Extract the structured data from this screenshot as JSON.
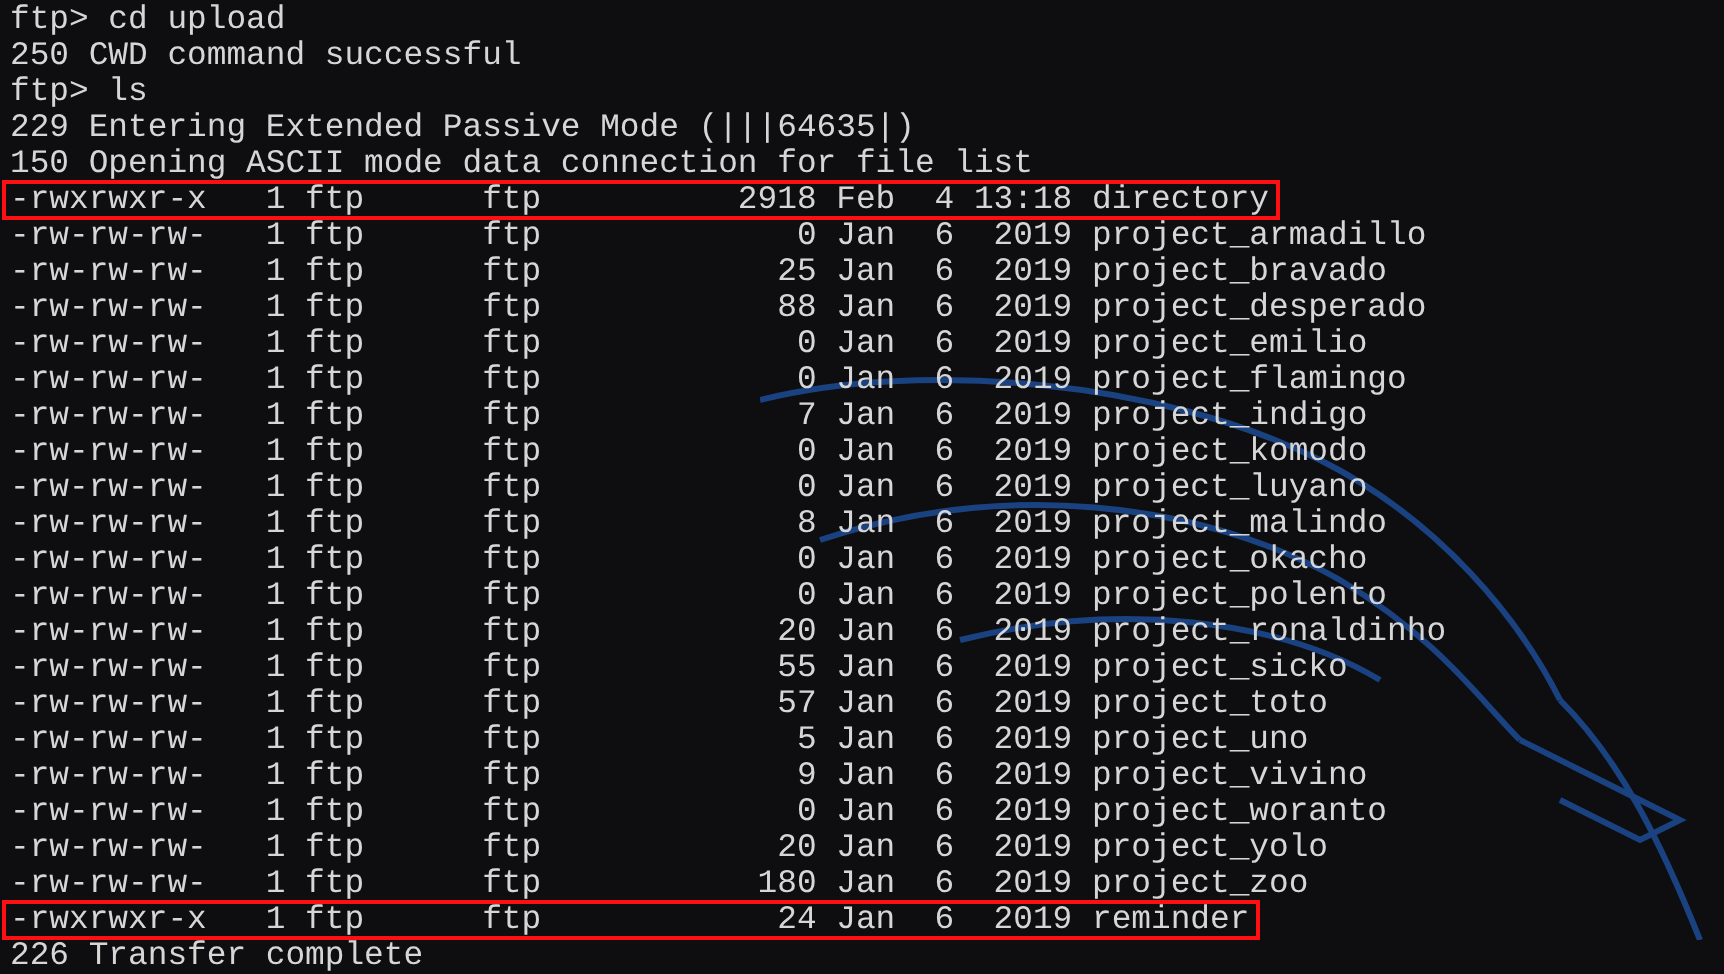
{
  "terminal": {
    "lines": [
      {
        "text": "ftp> cd upload",
        "highlighted": false
      },
      {
        "text": "250 CWD command successful",
        "highlighted": false
      },
      {
        "text": "ftp> ls",
        "highlighted": false
      },
      {
        "text": "229 Entering Extended Passive Mode (|||64635|)",
        "highlighted": false
      },
      {
        "text": "150 Opening ASCII mode data connection for file list",
        "highlighted": false
      },
      {
        "text": "-rwxrwxr-x   1 ftp      ftp          2918 Feb  4 13:18 directory",
        "highlighted": true
      },
      {
        "text": "-rw-rw-rw-   1 ftp      ftp             0 Jan  6  2019 project_armadillo",
        "highlighted": false
      },
      {
        "text": "-rw-rw-rw-   1 ftp      ftp            25 Jan  6  2019 project_bravado",
        "highlighted": false
      },
      {
        "text": "-rw-rw-rw-   1 ftp      ftp            88 Jan  6  2019 project_desperado",
        "highlighted": false
      },
      {
        "text": "-rw-rw-rw-   1 ftp      ftp             0 Jan  6  2019 project_emilio",
        "highlighted": false
      },
      {
        "text": "-rw-rw-rw-   1 ftp      ftp             0 Jan  6  2019 project_flamingo",
        "highlighted": false
      },
      {
        "text": "-rw-rw-rw-   1 ftp      ftp             7 Jan  6  2019 project_indigo",
        "highlighted": false
      },
      {
        "text": "-rw-rw-rw-   1 ftp      ftp             0 Jan  6  2019 project_komodo",
        "highlighted": false
      },
      {
        "text": "-rw-rw-rw-   1 ftp      ftp             0 Jan  6  2019 project_luyano",
        "highlighted": false
      },
      {
        "text": "-rw-rw-rw-   1 ftp      ftp             8 Jan  6  2019 project_malindo",
        "highlighted": false
      },
      {
        "text": "-rw-rw-rw-   1 ftp      ftp             0 Jan  6  2019 project_okacho",
        "highlighted": false
      },
      {
        "text": "-rw-rw-rw-   1 ftp      ftp             0 Jan  6  2019 project_polento",
        "highlighted": false
      },
      {
        "text": "-rw-rw-rw-   1 ftp      ftp            20 Jan  6  2019 project_ronaldinho",
        "highlighted": false
      },
      {
        "text": "-rw-rw-rw-   1 ftp      ftp            55 Jan  6  2019 project_sicko",
        "highlighted": false
      },
      {
        "text": "-rw-rw-rw-   1 ftp      ftp            57 Jan  6  2019 project_toto",
        "highlighted": false
      },
      {
        "text": "-rw-rw-rw-   1 ftp      ftp             5 Jan  6  2019 project_uno",
        "highlighted": false
      },
      {
        "text": "-rw-rw-rw-   1 ftp      ftp             9 Jan  6  2019 project_vivino",
        "highlighted": false
      },
      {
        "text": "-rw-rw-rw-   1 ftp      ftp             0 Jan  6  2019 project_woranto",
        "highlighted": false
      },
      {
        "text": "-rw-rw-rw-   1 ftp      ftp            20 Jan  6  2019 project_yolo",
        "highlighted": false
      },
      {
        "text": "-rw-rw-rw-   1 ftp      ftp           180 Jan  6  2019 project_zoo",
        "highlighted": false
      },
      {
        "text": "-rwxrwxr-x   1 ftp      ftp            24 Jan  6  2019 reminder",
        "highlighted": true
      },
      {
        "text": "226 Transfer complete",
        "highlighted": false
      }
    ]
  }
}
